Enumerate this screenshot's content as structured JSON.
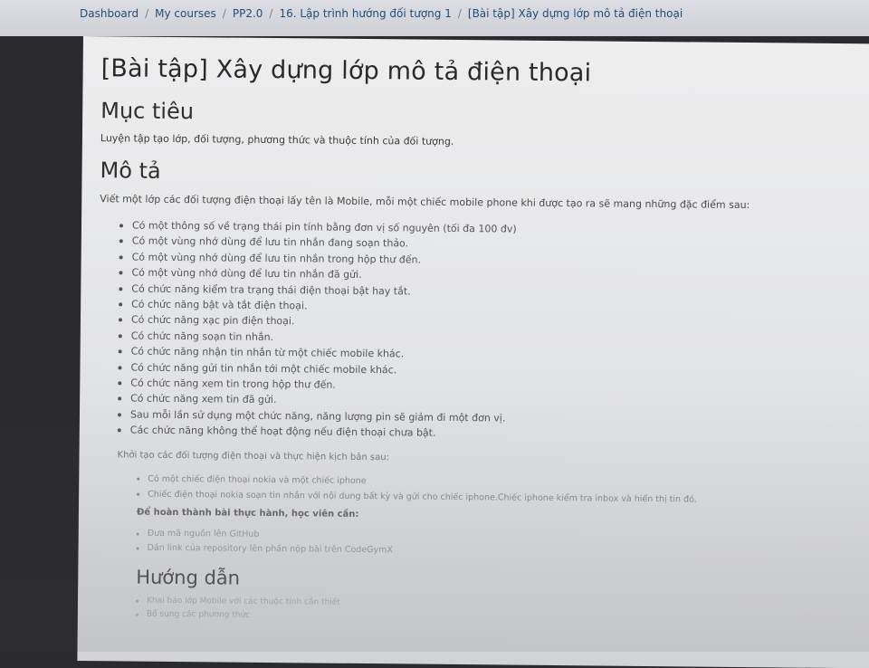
{
  "breadcrumb": {
    "items": [
      "Dashboard",
      "My courses",
      "PP2.0",
      "16. Lập trình hướng đối tượng 1",
      "[Bài tập] Xây dựng lớp mô tả điện thoại"
    ],
    "separator": "/"
  },
  "page": {
    "title": "[Bài tập] Xây dựng lớp mô tả điện thoại",
    "goal_heading": "Mục tiêu",
    "goal_text": "Luyện tập tạo lớp, đối tượng, phương thức và thuộc tính của đối tượng.",
    "desc_heading": "Mô tả",
    "desc_text": "Viết một lớp các đối tượng điện thoại lấy tên là Mobile, mỗi một chiếc mobile phone khi được tạo ra sẽ mang những đặc điểm sau:",
    "features": [
      "Có một thông số về trạng thái pin tính bằng đơn vị số nguyên (tối đa 100 đv)",
      "Có một vùng nhớ dùng để lưu tin nhắn đang soạn thảo.",
      "Có một vùng nhớ dùng để lưu tin nhắn trong hộp thư đến.",
      "Có một vùng nhớ dùng để lưu tin nhắn đã gửi.",
      "Có chức năng kiểm tra trạng thái điện thoại bật hay tắt.",
      "Có chức năng bật và tắt điện thoại.",
      "Có chức năng xạc pin điện thoại.",
      "Có chức năng soạn tin nhắn.",
      "Có chức năng nhận tin nhắn từ một chiếc mobile khác.",
      "Có chức năng gửi tin nhắn tới một chiếc mobile khác.",
      "Có chức năng xem tin trong hộp thư đến.",
      "Có chức năng xem tin đã gửi.",
      "Sau mỗi lần sử dụng một chức năng, năng lượng pin sẽ giảm đi một đơn vị.",
      "Các chức năng không thể hoạt động nếu điện thoại chưa bật."
    ],
    "init_text": "Khởi tạo các đối tượng điện thoại và thực hiện kịch bản sau:",
    "scenario": [
      "Có một chiếc điện thoại nokia và một chiếc iphone",
      "Chiếc điện thoại nokia soạn tin nhắn với nội dung bất kỳ và gửi cho chiếc iphone.Chiếc iphone kiểm tra inbox và hiển thị tin đó."
    ],
    "req_heading": "Để hoàn thành bài thực hành, học viên cần:",
    "requirements": [
      "Đưa mã nguồn lên GitHub",
      "Dán link của repository lên phần nộp bài trên CodeGymX"
    ],
    "guide_heading": "Hướng dẫn",
    "guide": [
      "Khai báo lớp Mobile với các thuộc tính cần thiết",
      "Bổ sung các phương thức"
    ]
  },
  "colors": {
    "link": "#1f4f7a",
    "page_bg": "#eeeeef",
    "text": "#333333"
  }
}
